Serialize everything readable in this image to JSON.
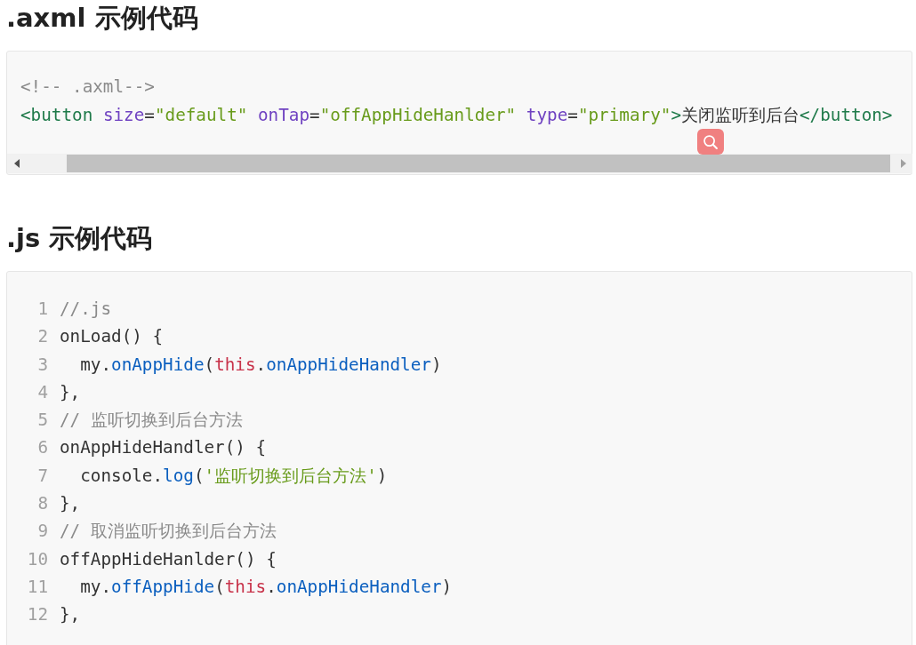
{
  "sections": [
    {
      "heading": ".axml 示例代码",
      "code_block": {
        "kind": "scrolling",
        "lines": [
          {
            "tokens": [
              {
                "text": "<!-- .axml-->",
                "kind": "comment"
              }
            ]
          },
          {
            "tokens": [
              {
                "text": "<button ",
                "kind": "tag"
              },
              {
                "text": "size",
                "kind": "attr"
              },
              {
                "text": "=",
                "kind": "plain"
              },
              {
                "text": "\"default\" ",
                "kind": "string"
              },
              {
                "text": "onTap",
                "kind": "attr"
              },
              {
                "text": "=",
                "kind": "plain"
              },
              {
                "text": "\"offAppHideHanlder\" ",
                "kind": "string"
              },
              {
                "text": "type",
                "kind": "attr"
              },
              {
                "text": "=",
                "kind": "plain"
              },
              {
                "text": "\"primary\"",
                "kind": "string"
              },
              {
                "text": ">",
                "kind": "tag"
              },
              {
                "text": "关闭监听到后台",
                "kind": "plain"
              },
              {
                "text": "</button>",
                "kind": "tag"
              }
            ]
          }
        ]
      }
    },
    {
      "heading": ".js 示例代码",
      "code_block": {
        "kind": "numbered",
        "lines": [
          {
            "number": "1",
            "tokens": [
              {
                "text": "//.js",
                "kind": "comment"
              }
            ]
          },
          {
            "number": "2",
            "tokens": [
              {
                "text": "onLoad() {",
                "kind": "plain"
              }
            ]
          },
          {
            "number": "3",
            "tokens": [
              {
                "text": "  my.",
                "kind": "plain"
              },
              {
                "text": "onAppHide",
                "kind": "func"
              },
              {
                "text": "(",
                "kind": "plain"
              },
              {
                "text": "this",
                "kind": "keyword"
              },
              {
                "text": ".",
                "kind": "plain"
              },
              {
                "text": "onAppHideHandler",
                "kind": "func"
              },
              {
                "text": ")",
                "kind": "plain"
              }
            ]
          },
          {
            "number": "4",
            "tokens": [
              {
                "text": "},",
                "kind": "plain"
              }
            ]
          },
          {
            "number": "5",
            "tokens": [
              {
                "text": "// 监听切换到后台方法",
                "kind": "comment"
              }
            ]
          },
          {
            "number": "6",
            "tokens": [
              {
                "text": "onAppHideHandler() {",
                "kind": "plain"
              }
            ]
          },
          {
            "number": "7",
            "tokens": [
              {
                "text": "  console.",
                "kind": "plain"
              },
              {
                "text": "log",
                "kind": "func"
              },
              {
                "text": "(",
                "kind": "plain"
              },
              {
                "text": "'监听切换到后台方法'",
                "kind": "string"
              },
              {
                "text": ")",
                "kind": "plain"
              }
            ]
          },
          {
            "number": "8",
            "tokens": [
              {
                "text": "},",
                "kind": "plain"
              }
            ]
          },
          {
            "number": "9",
            "tokens": [
              {
                "text": "// 取消监听切换到后台方法",
                "kind": "comment"
              }
            ]
          },
          {
            "number": "10",
            "tokens": [
              {
                "text": "offAppHideHanlder() {",
                "kind": "plain"
              }
            ]
          },
          {
            "number": "11",
            "tokens": [
              {
                "text": "  my.",
                "kind": "plain"
              },
              {
                "text": "offAppHide",
                "kind": "func"
              },
              {
                "text": "(",
                "kind": "plain"
              },
              {
                "text": "this",
                "kind": "keyword"
              },
              {
                "text": ".",
                "kind": "plain"
              },
              {
                "text": "onAppHideHandler",
                "kind": "func"
              },
              {
                "text": ")",
                "kind": "plain"
              }
            ]
          },
          {
            "number": "12",
            "tokens": [
              {
                "text": "},",
                "kind": "plain"
              }
            ]
          }
        ]
      }
    }
  ]
}
